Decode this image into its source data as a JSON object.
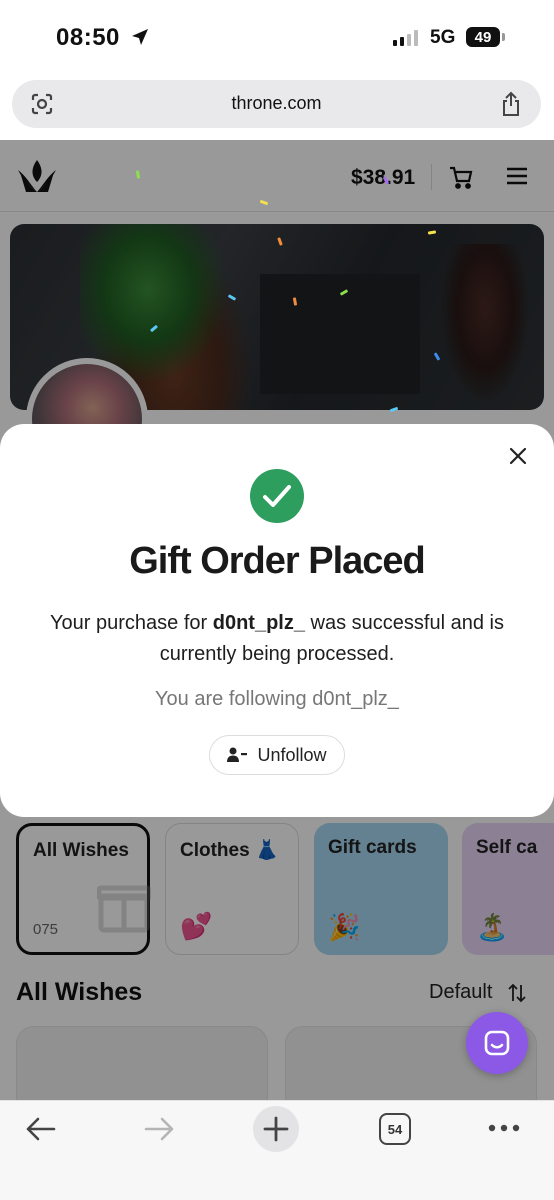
{
  "status_bar": {
    "time": "08:50",
    "network": "5G",
    "battery": "49"
  },
  "browser": {
    "url": "throne.com",
    "tab_count": "54"
  },
  "site": {
    "balance": "$38.91",
    "categories": [
      {
        "label": "All Wishes",
        "count": "075",
        "selected": true
      },
      {
        "label": "Clothes 👗",
        "emoji": "💕",
        "color": "#ffffff"
      },
      {
        "label": "Gift cards",
        "emoji": "🎉",
        "color": "#a7d8f2"
      },
      {
        "label": "Self ca",
        "emoji": "🏝️",
        "color": "#e8d5f7"
      }
    ],
    "section_title": "All Wishes",
    "sort_label": "Default"
  },
  "modal": {
    "title": "Gift Order Placed",
    "message_prefix": "Your purchase for ",
    "username": "d0nt_plz_",
    "message_suffix": " was successful and is currently being processed.",
    "follow_status": "You are following d0nt_plz_",
    "unfollow_label": "Unfollow"
  },
  "colors": {
    "success": "#2e9e5e",
    "chat": "#8b59e6",
    "accent": "#111111"
  }
}
